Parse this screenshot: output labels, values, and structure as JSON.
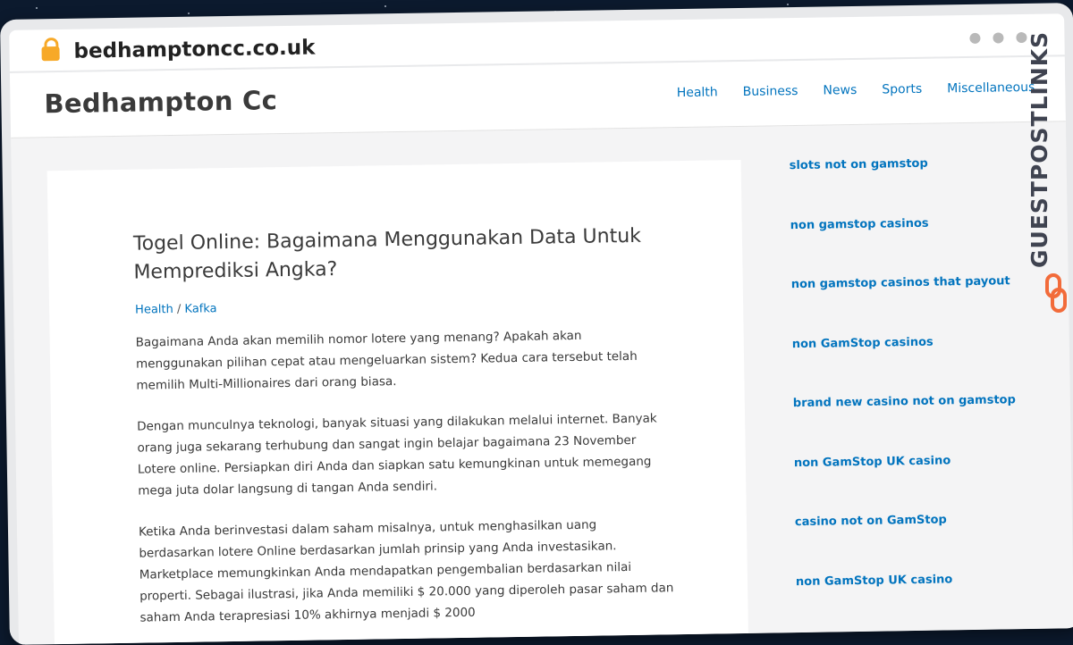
{
  "browser": {
    "url": "bedhamptoncc.co.uk"
  },
  "site": {
    "title": "Bedhampton Cc",
    "nav": [
      "Health",
      "Business",
      "News",
      "Sports",
      "Miscellaneous"
    ]
  },
  "article": {
    "title": "Togel Online: Bagaimana Menggunakan Data Untuk Memprediksi Angka?",
    "category": "Health",
    "separator": "/",
    "author": "Kafka",
    "paragraphs": [
      "Bagaimana Anda akan memilih nomor lotere yang menang? Apakah akan menggunakan pilihan cepat atau mengeluarkan sistem? Kedua cara tersebut telah memilih Multi-Millionaires dari orang biasa.",
      "Dengan munculnya teknologi, banyak situasi yang dilakukan melalui internet. Banyak orang juga sekarang terhubung dan sangat ingin belajar bagaimana 23 November Lotere online. Persiapkan diri Anda dan siapkan satu kemungkinan untuk memegang mega juta dolar langsung di tangan Anda sendiri.",
      "Ketika Anda berinvestasi dalam saham misalnya, untuk menghasilkan uang berdasarkan lotere Online berdasarkan jumlah prinsip yang Anda investasikan. Marketplace memungkinkan Anda mendapatkan pengembalian berdasarkan nilai properti. Sebagai ilustrasi, jika Anda memiliki $ 20.000 yang diperoleh pasar saham dan saham Anda terapresiasi 10% akhirnya menjadi $ 2000"
    ]
  },
  "sidebar": {
    "links": [
      "slots not on gamstop",
      "non gamstop casinos",
      "non gamstop casinos that payout",
      "non GamStop casinos",
      "brand new casino not on gamstop",
      "non GamStop UK casino",
      "casino not on GamStop",
      "non GamStop UK casino"
    ]
  },
  "watermark": {
    "text": "GUESTPOSTLINKS",
    "color": "#3f4350",
    "logo_color": "#f26b3a"
  },
  "colors": {
    "link": "#0274be",
    "background": "#0c1a2e"
  }
}
